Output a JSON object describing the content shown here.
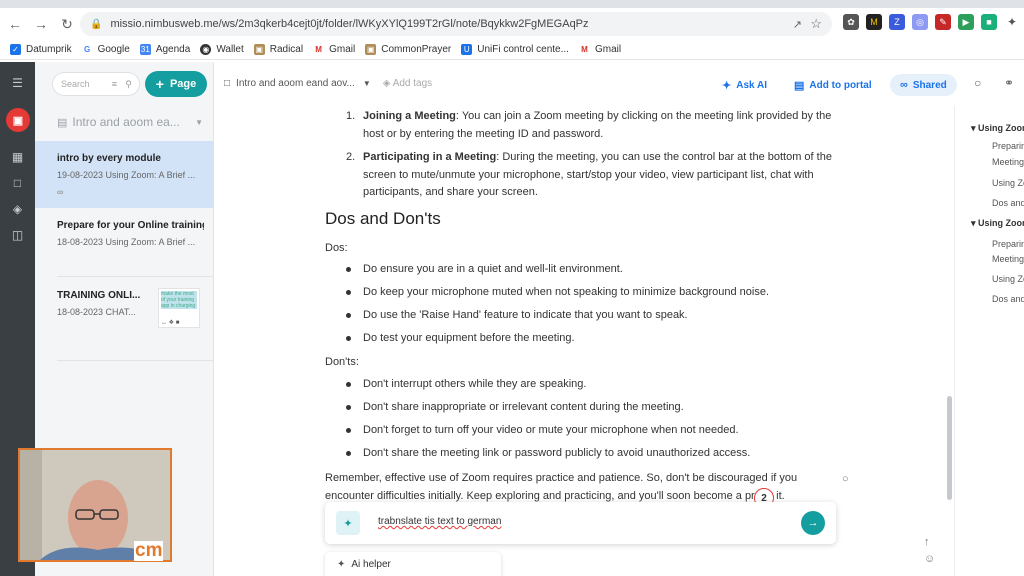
{
  "browser": {
    "url": "missio.nimbusweb.me/ws/2m3qkerb4cejt0jt/folder/lWKyXYlQ199T2rGl/note/Bqykkw2FgMEGAqPz",
    "bookmarks": [
      "Datumprik",
      "Google",
      "Agenda",
      "Wallet",
      "Radical",
      "Gmail",
      "CommonPrayer",
      "UniFi control cente...",
      "Gmail"
    ]
  },
  "notelist": {
    "search_placeholder": "Search",
    "page_button": "Page",
    "folder_title": "Intro and aoom ea...",
    "notes": [
      {
        "title": "intro by every module",
        "subtitle": "19-08-2023 Using Zoom: A Brief ..."
      },
      {
        "title": "Prepare for your Online training",
        "subtitle": "18-08-2023 Using Zoom: A Brief ..."
      },
      {
        "title": "TRAINING ONLI...",
        "subtitle": "18-08-2023 CHAT...",
        "thumb_text": "make the most of your training app in charging",
        "thumb_icons": "↔ ❖ ■"
      }
    ]
  },
  "topbar": {
    "breadcrumb": "Intro and aoom eand aov...",
    "add_tags": "Add tags",
    "ask_ai": "Ask AI",
    "add_portal": "Add to portal",
    "shared": "Shared"
  },
  "doc": {
    "ol": [
      {
        "num": "1.",
        "bold": "Joining a Meeting",
        "text": ": You can join a Zoom meeting by clicking on the meeting link provided by the host or by entering the meeting ID and password."
      },
      {
        "num": "2.",
        "bold": "Participating in a Meeting",
        "text": ": During the meeting, you can use the control bar at the bottom of the screen to mute/unmute your microphone, start/stop your video, view participant list, chat with participants, and share your screen."
      }
    ],
    "heading": "Dos and Don'ts",
    "dos_label": "Dos:",
    "dos": [
      "Do ensure you are in a quiet and well-lit environment.",
      "Do keep your microphone muted when not speaking to minimize background noise.",
      "Do use the 'Raise Hand' feature to indicate that you want to speak.",
      "Do test your equipment before the meeting."
    ],
    "donts_label": "Don'ts:",
    "donts": [
      "Don't interrupt others while they are speaking.",
      "Don't share inappropriate or irrelevant content during the meeting.",
      "Don't forget to turn off your video or mute your microphone when not needed.",
      "Don't share the meeting link or password publicly to avoid unauthorized access."
    ],
    "closing": "Remember, effective use of Zoom requires practice and patience. So, don't be discouraged if you encounter difficulties initially. Keep exploring and practicing, and you'll soon become a pro at it."
  },
  "ai": {
    "input_text": "trabnslate tis text to german",
    "badge": "2",
    "helper": "Ai helper"
  },
  "outline": [
    {
      "text": "Using Zoom",
      "level": "h"
    },
    {
      "text": "Preparin",
      "level": "s"
    },
    {
      "text": "Meeting",
      "level": "s"
    },
    {
      "text": "Using Zo",
      "level": "s"
    },
    {
      "text": "Dos and",
      "level": "s"
    },
    {
      "text": "Using Zoom",
      "level": "h"
    },
    {
      "text": "Preparin",
      "level": "s"
    },
    {
      "text": "Meeting",
      "level": "s"
    },
    {
      "text": "Using Zo",
      "level": "s"
    },
    {
      "text": "Dos and",
      "level": "s"
    }
  ],
  "webcam": {
    "brand": "cm"
  },
  "colors": {
    "accent": "#159e9f",
    "link": "#1a73e8",
    "selected": "#d2e3f7",
    "rail": "#3a3f44"
  }
}
